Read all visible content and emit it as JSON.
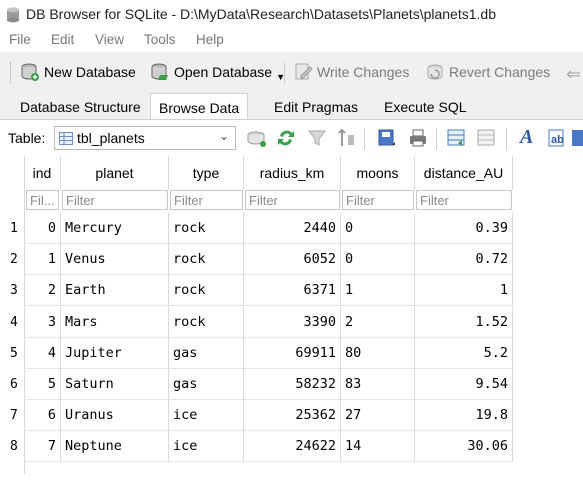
{
  "window": {
    "title": "DB Browser for SQLite - D:\\MyData\\Research\\Datasets\\Planets\\planets1.db"
  },
  "menu": [
    "File",
    "Edit",
    "View",
    "Tools",
    "Help"
  ],
  "toolbar": {
    "new_database": "New Database",
    "open_database": "Open Database",
    "write_changes": "Write Changes",
    "revert_changes": "Revert Changes"
  },
  "tabs": [
    {
      "label": "Database Structure",
      "active": false
    },
    {
      "label": "Browse Data",
      "active": true
    },
    {
      "label": "Edit Pragmas",
      "active": false
    },
    {
      "label": "Execute SQL",
      "active": false
    }
  ],
  "table_selector": {
    "label": "Table:",
    "value": "tbl_planets"
  },
  "grid": {
    "columns": [
      "ind",
      "planet",
      "type",
      "radius_km",
      "moons",
      "distance_AU"
    ],
    "filters": [
      "Fil...",
      "Filter",
      "Filter",
      "Filter",
      "Filter",
      "Filter"
    ],
    "rows": [
      {
        "num": "1",
        "cells": [
          "0",
          "Mercury",
          "rock",
          "2440",
          "0",
          "0.39"
        ]
      },
      {
        "num": "2",
        "cells": [
          "1",
          "Venus",
          "rock",
          "6052",
          "0",
          "0.72"
        ]
      },
      {
        "num": "3",
        "cells": [
          "2",
          "Earth",
          "rock",
          "6371",
          "1",
          "1"
        ]
      },
      {
        "num": "4",
        "cells": [
          "3",
          "Mars",
          "rock",
          "3390",
          "2",
          "1.52"
        ]
      },
      {
        "num": "5",
        "cells": [
          "4",
          "Jupiter",
          "gas",
          "69911",
          "80",
          "5.2"
        ]
      },
      {
        "num": "6",
        "cells": [
          "5",
          "Saturn",
          "gas",
          "58232",
          "83",
          "9.54"
        ]
      },
      {
        "num": "7",
        "cells": [
          "6",
          "Uranus",
          "ice",
          "25362",
          "27",
          "19.8"
        ]
      },
      {
        "num": "8",
        "cells": [
          "7",
          "Neptune",
          "ice",
          "24622",
          "14",
          "30.06"
        ]
      }
    ]
  }
}
